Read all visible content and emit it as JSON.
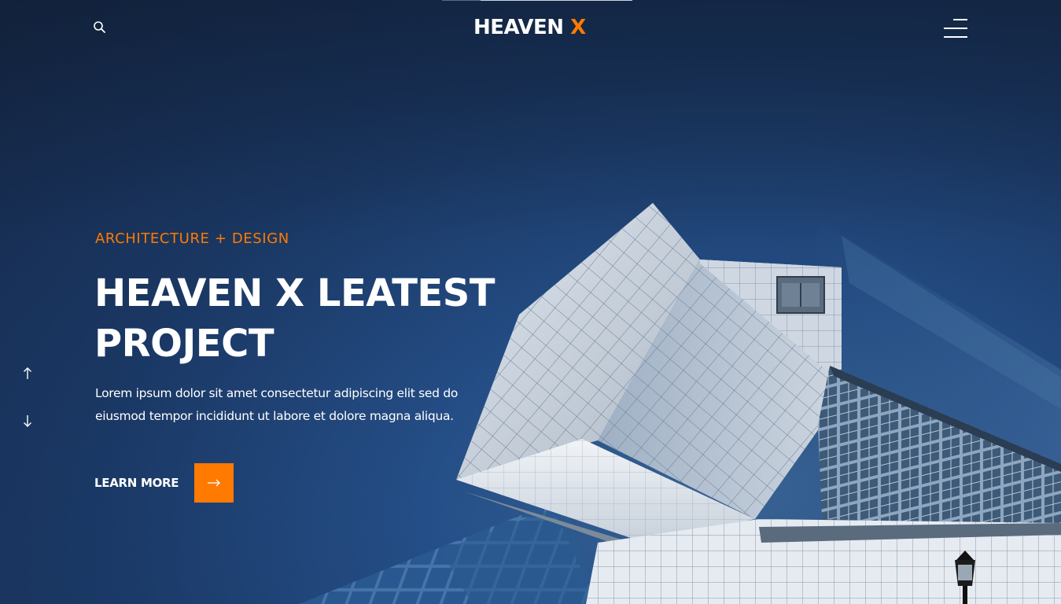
{
  "header": {
    "logo_main": "HEAVEN",
    "logo_accent": "X",
    "search_icon": "search-icon",
    "menu_icon": "hamburger-menu-icon"
  },
  "hero": {
    "eyebrow": "ARCHITECTURE + DESIGN",
    "headline_line1": "HEAVEN X LEATEST",
    "headline_line2": "PROJECT",
    "description": "Lorem ipsum dolor sit amet consectetur adipiscing elit sed do eiusmod tempor incididunt ut labore et dolore magna aliqua.",
    "cta_label": "LEARN MORE",
    "cta_icon": "arrow-right-icon"
  },
  "slider_nav": {
    "prev_icon": "arrow-up-icon",
    "next_icon": "arrow-down-icon"
  },
  "colors": {
    "accent": "#ff7a00",
    "background": "#1b3a68",
    "text": "#ffffff"
  }
}
